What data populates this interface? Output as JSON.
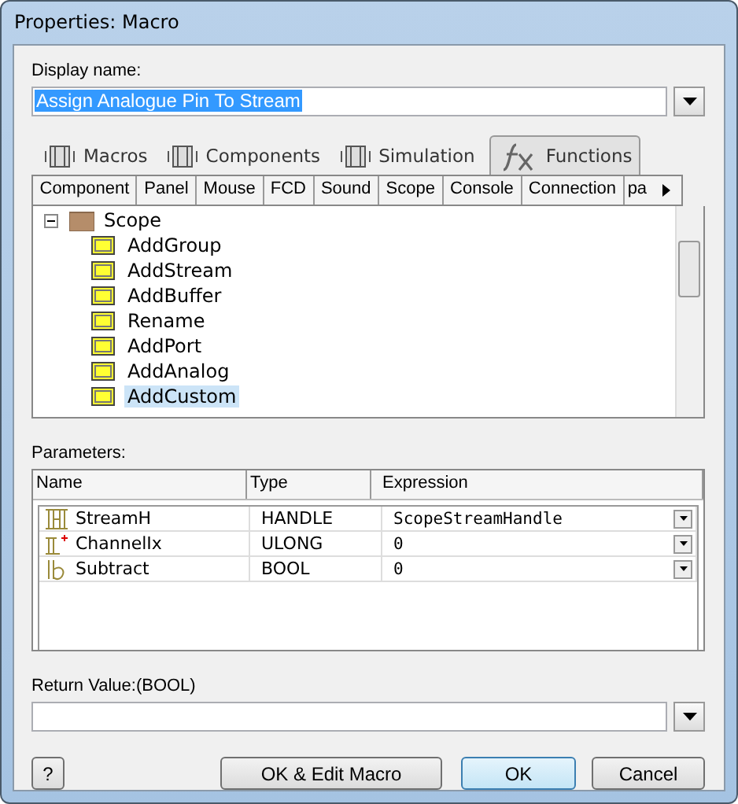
{
  "window": {
    "title": "Properties: Macro"
  },
  "display_name": {
    "label": "Display name:",
    "value": "Assign Analogue Pin To Stream"
  },
  "tabs": [
    {
      "label": "Macros",
      "selected": false
    },
    {
      "label": "Components",
      "selected": false
    },
    {
      "label": "Simulation",
      "selected": false
    },
    {
      "label": "Functions",
      "selected": true
    }
  ],
  "sub_tabs": [
    "Component",
    "Panel",
    "Mouse",
    "FCD",
    "Sound",
    "Scope",
    "Console",
    "Connection",
    "pa"
  ],
  "tree": {
    "label": "Scope",
    "expanded": true,
    "children": [
      {
        "label": "AddGroup",
        "selected": false
      },
      {
        "label": "AddStream",
        "selected": false
      },
      {
        "label": "AddBuffer",
        "selected": false
      },
      {
        "label": "Rename",
        "selected": false
      },
      {
        "label": "AddPort",
        "selected": false
      },
      {
        "label": "AddAnalog",
        "selected": false
      },
      {
        "label": "AddCustom",
        "selected": true
      }
    ]
  },
  "parameters": {
    "label": "Parameters:",
    "columns": [
      "Name",
      "Type",
      "Expression"
    ],
    "rows": [
      {
        "kind": "handle",
        "name": "StreamH",
        "type": "HANDLE",
        "expression": "ScopeStreamHandle"
      },
      {
        "kind": "ulong",
        "name": "ChannelIx",
        "type": "ULONG",
        "expression": "0"
      },
      {
        "kind": "bool",
        "name": "Subtract",
        "type": "BOOL",
        "expression": "0"
      }
    ]
  },
  "return_value": {
    "label": "Return Value:(BOOL)"
  },
  "buttons": {
    "help": "?",
    "edit": "OK & Edit Macro",
    "ok": "OK",
    "cancel": "Cancel"
  }
}
